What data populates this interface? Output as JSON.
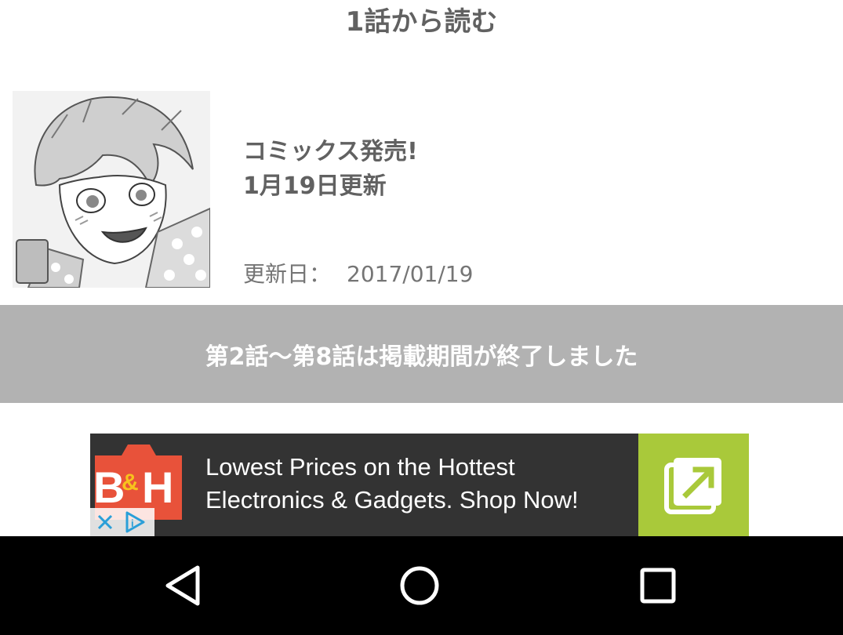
{
  "header": {
    "read_from_first": "1話から読む"
  },
  "episode": {
    "title_line1": "コミックス発売!",
    "title_line2": "1月19日更新",
    "update_label": "更新日：",
    "update_date": "2017/01/19"
  },
  "notice": {
    "expired_text": "第2話〜第8話は掲載期間が終了しました"
  },
  "ad": {
    "brand": "B&H",
    "line1": "Lowest Prices on the Hottest",
    "line2": "Electronics & Gadgets. Shop Now!",
    "open_icon": "external-link-icon",
    "accent_color": "#a9c93a",
    "logo_color": "#e8523a"
  },
  "nav": {
    "back_icon": "back-triangle-icon",
    "home_icon": "home-circle-icon",
    "recents_icon": "recents-square-icon"
  }
}
